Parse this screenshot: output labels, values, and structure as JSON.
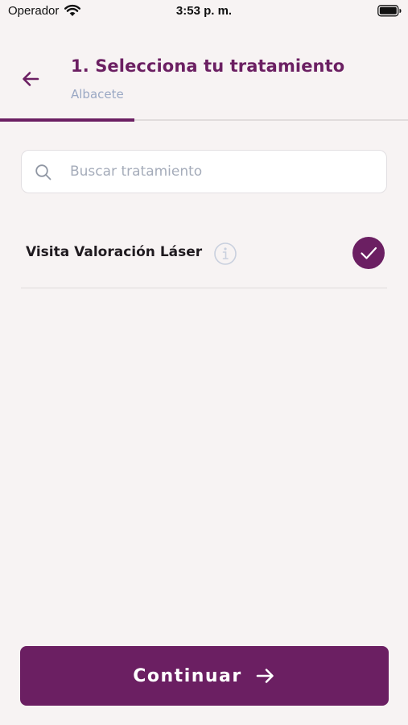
{
  "status_bar": {
    "carrier": "Operador",
    "time": "3:53 p. m."
  },
  "header": {
    "title": "1. Selecciona tu tratamiento",
    "location": "Albacete",
    "progress_fraction": 0.33
  },
  "search": {
    "placeholder": "Buscar tratamiento",
    "value": ""
  },
  "treatments": [
    {
      "name": "Visita Valoración Láser",
      "selected": true
    }
  ],
  "footer": {
    "continue_label": "Continuar"
  },
  "colors": {
    "accent": "#6b1f62",
    "subtitle": "#9aa8c4",
    "background": "#f7f3f3"
  }
}
